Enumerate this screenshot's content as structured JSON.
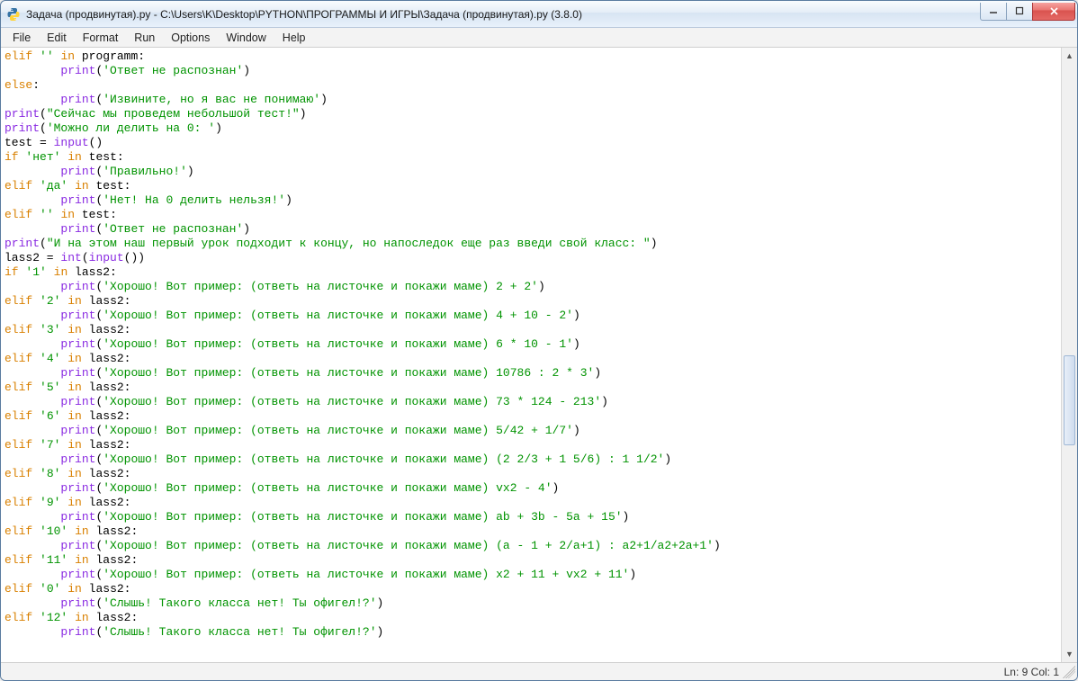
{
  "window": {
    "title": "Задача (продвинутая).py - C:\\Users\\K\\Desktop\\PYTHON\\ПРОГРАММЫ И ИГРЫ\\Задача (продвинутая).py (3.8.0)"
  },
  "menu": {
    "file": "File",
    "edit": "Edit",
    "format": "Format",
    "run": "Run",
    "options": "Options",
    "window": "Window",
    "help": "Help"
  },
  "status": {
    "position": "Ln: 9  Col: 1"
  },
  "code": {
    "lines": [
      [
        {
          "t": "kw",
          "v": "elif"
        },
        {
          "t": "op",
          "v": " "
        },
        {
          "t": "str",
          "v": "''"
        },
        {
          "t": "op",
          "v": " "
        },
        {
          "t": "kw",
          "v": "in"
        },
        {
          "t": "op",
          "v": " programm:"
        }
      ],
      [
        {
          "t": "op",
          "v": "        "
        },
        {
          "t": "fn",
          "v": "print"
        },
        {
          "t": "op",
          "v": "("
        },
        {
          "t": "str",
          "v": "'Ответ не распознан'"
        },
        {
          "t": "op",
          "v": ")"
        }
      ],
      [
        {
          "t": "kw",
          "v": "else"
        },
        {
          "t": "op",
          "v": ":"
        }
      ],
      [
        {
          "t": "op",
          "v": "        "
        },
        {
          "t": "fn",
          "v": "print"
        },
        {
          "t": "op",
          "v": "("
        },
        {
          "t": "str",
          "v": "'Извините, но я вас не понимаю'"
        },
        {
          "t": "op",
          "v": ")"
        }
      ],
      [
        {
          "t": "fn",
          "v": "print"
        },
        {
          "t": "op",
          "v": "("
        },
        {
          "t": "str",
          "v": "\"Сейчас мы проведем небольшой тест!\""
        },
        {
          "t": "op",
          "v": ")"
        }
      ],
      [
        {
          "t": "fn",
          "v": "print"
        },
        {
          "t": "op",
          "v": "("
        },
        {
          "t": "str",
          "v": "'Можно ли делить на 0: '"
        },
        {
          "t": "op",
          "v": ")"
        }
      ],
      [
        {
          "t": "op",
          "v": "test = "
        },
        {
          "t": "fn",
          "v": "input"
        },
        {
          "t": "op",
          "v": "()"
        }
      ],
      [
        {
          "t": "kw",
          "v": "if"
        },
        {
          "t": "op",
          "v": " "
        },
        {
          "t": "str",
          "v": "'нет'"
        },
        {
          "t": "op",
          "v": " "
        },
        {
          "t": "kw",
          "v": "in"
        },
        {
          "t": "op",
          "v": " test:"
        }
      ],
      [
        {
          "t": "op",
          "v": "        "
        },
        {
          "t": "fn",
          "v": "print"
        },
        {
          "t": "op",
          "v": "("
        },
        {
          "t": "str",
          "v": "'Правильно!'"
        },
        {
          "t": "op",
          "v": ")"
        }
      ],
      [
        {
          "t": "kw",
          "v": "elif"
        },
        {
          "t": "op",
          "v": " "
        },
        {
          "t": "str",
          "v": "'да'"
        },
        {
          "t": "op",
          "v": " "
        },
        {
          "t": "kw",
          "v": "in"
        },
        {
          "t": "op",
          "v": " test:"
        }
      ],
      [
        {
          "t": "op",
          "v": "        "
        },
        {
          "t": "fn",
          "v": "print"
        },
        {
          "t": "op",
          "v": "("
        },
        {
          "t": "str",
          "v": "'Нет! На 0 делить нельзя!'"
        },
        {
          "t": "op",
          "v": ")"
        }
      ],
      [
        {
          "t": "kw",
          "v": "elif"
        },
        {
          "t": "op",
          "v": " "
        },
        {
          "t": "str",
          "v": "''"
        },
        {
          "t": "op",
          "v": " "
        },
        {
          "t": "kw",
          "v": "in"
        },
        {
          "t": "op",
          "v": " test:"
        }
      ],
      [
        {
          "t": "op",
          "v": "        "
        },
        {
          "t": "fn",
          "v": "print"
        },
        {
          "t": "op",
          "v": "("
        },
        {
          "t": "str",
          "v": "'Ответ не распознан'"
        },
        {
          "t": "op",
          "v": ")"
        }
      ],
      [
        {
          "t": "fn",
          "v": "print"
        },
        {
          "t": "op",
          "v": "("
        },
        {
          "t": "str",
          "v": "\"И на этом наш первый урок подходит к концу, но напоследок еще раз введи свой класс: \""
        },
        {
          "t": "op",
          "v": ")"
        }
      ],
      [
        {
          "t": "op",
          "v": "lass2 = "
        },
        {
          "t": "fn",
          "v": "int"
        },
        {
          "t": "op",
          "v": "("
        },
        {
          "t": "fn",
          "v": "input"
        },
        {
          "t": "op",
          "v": "())"
        }
      ],
      [
        {
          "t": "kw",
          "v": "if"
        },
        {
          "t": "op",
          "v": " "
        },
        {
          "t": "str",
          "v": "'1'"
        },
        {
          "t": "op",
          "v": " "
        },
        {
          "t": "kw",
          "v": "in"
        },
        {
          "t": "op",
          "v": " lass2:"
        }
      ],
      [
        {
          "t": "op",
          "v": "        "
        },
        {
          "t": "fn",
          "v": "print"
        },
        {
          "t": "op",
          "v": "("
        },
        {
          "t": "str",
          "v": "'Хорошо! Вот пример: (ответь на листочке и покажи маме) 2 + 2'"
        },
        {
          "t": "op",
          "v": ")"
        }
      ],
      [
        {
          "t": "kw",
          "v": "elif"
        },
        {
          "t": "op",
          "v": " "
        },
        {
          "t": "str",
          "v": "'2'"
        },
        {
          "t": "op",
          "v": " "
        },
        {
          "t": "kw",
          "v": "in"
        },
        {
          "t": "op",
          "v": " lass2:"
        }
      ],
      [
        {
          "t": "op",
          "v": "        "
        },
        {
          "t": "fn",
          "v": "print"
        },
        {
          "t": "op",
          "v": "("
        },
        {
          "t": "str",
          "v": "'Хорошо! Вот пример: (ответь на листочке и покажи маме) 4 + 10 - 2'"
        },
        {
          "t": "op",
          "v": ")"
        }
      ],
      [
        {
          "t": "kw",
          "v": "elif"
        },
        {
          "t": "op",
          "v": " "
        },
        {
          "t": "str",
          "v": "'3'"
        },
        {
          "t": "op",
          "v": " "
        },
        {
          "t": "kw",
          "v": "in"
        },
        {
          "t": "op",
          "v": " lass2:"
        }
      ],
      [
        {
          "t": "op",
          "v": "        "
        },
        {
          "t": "fn",
          "v": "print"
        },
        {
          "t": "op",
          "v": "("
        },
        {
          "t": "str",
          "v": "'Хорошо! Вот пример: (ответь на листочке и покажи маме) 6 * 10 - 1'"
        },
        {
          "t": "op",
          "v": ")"
        }
      ],
      [
        {
          "t": "kw",
          "v": "elif"
        },
        {
          "t": "op",
          "v": " "
        },
        {
          "t": "str",
          "v": "'4'"
        },
        {
          "t": "op",
          "v": " "
        },
        {
          "t": "kw",
          "v": "in"
        },
        {
          "t": "op",
          "v": " lass2:"
        }
      ],
      [
        {
          "t": "op",
          "v": "        "
        },
        {
          "t": "fn",
          "v": "print"
        },
        {
          "t": "op",
          "v": "("
        },
        {
          "t": "str",
          "v": "'Хорошо! Вот пример: (ответь на листочке и покажи маме) 10786 : 2 * 3'"
        },
        {
          "t": "op",
          "v": ")"
        }
      ],
      [
        {
          "t": "kw",
          "v": "elif"
        },
        {
          "t": "op",
          "v": " "
        },
        {
          "t": "str",
          "v": "'5'"
        },
        {
          "t": "op",
          "v": " "
        },
        {
          "t": "kw",
          "v": "in"
        },
        {
          "t": "op",
          "v": " lass2:"
        }
      ],
      [
        {
          "t": "op",
          "v": "        "
        },
        {
          "t": "fn",
          "v": "print"
        },
        {
          "t": "op",
          "v": "("
        },
        {
          "t": "str",
          "v": "'Хорошо! Вот пример: (ответь на листочке и покажи маме) 73 * 124 - 213'"
        },
        {
          "t": "op",
          "v": ")"
        }
      ],
      [
        {
          "t": "kw",
          "v": "elif"
        },
        {
          "t": "op",
          "v": " "
        },
        {
          "t": "str",
          "v": "'6'"
        },
        {
          "t": "op",
          "v": " "
        },
        {
          "t": "kw",
          "v": "in"
        },
        {
          "t": "op",
          "v": " lass2:"
        }
      ],
      [
        {
          "t": "op",
          "v": "        "
        },
        {
          "t": "fn",
          "v": "print"
        },
        {
          "t": "op",
          "v": "("
        },
        {
          "t": "str",
          "v": "'Хорошо! Вот пример: (ответь на листочке и покажи маме) 5/42 + 1/7'"
        },
        {
          "t": "op",
          "v": ")"
        }
      ],
      [
        {
          "t": "kw",
          "v": "elif"
        },
        {
          "t": "op",
          "v": " "
        },
        {
          "t": "str",
          "v": "'7'"
        },
        {
          "t": "op",
          "v": " "
        },
        {
          "t": "kw",
          "v": "in"
        },
        {
          "t": "op",
          "v": " lass2:"
        }
      ],
      [
        {
          "t": "op",
          "v": "        "
        },
        {
          "t": "fn",
          "v": "print"
        },
        {
          "t": "op",
          "v": "("
        },
        {
          "t": "str",
          "v": "'Хорошо! Вот пример: (ответь на листочке и покажи маме) (2 2/3 + 1 5/6) : 1 1/2'"
        },
        {
          "t": "op",
          "v": ")"
        }
      ],
      [
        {
          "t": "kw",
          "v": "elif"
        },
        {
          "t": "op",
          "v": " "
        },
        {
          "t": "str",
          "v": "'8'"
        },
        {
          "t": "op",
          "v": " "
        },
        {
          "t": "kw",
          "v": "in"
        },
        {
          "t": "op",
          "v": " lass2:"
        }
      ],
      [
        {
          "t": "op",
          "v": "        "
        },
        {
          "t": "fn",
          "v": "print"
        },
        {
          "t": "op",
          "v": "("
        },
        {
          "t": "str",
          "v": "'Хорошо! Вот пример: (ответь на листочке и покажи маме) vx2 - 4'"
        },
        {
          "t": "op",
          "v": ")"
        }
      ],
      [
        {
          "t": "kw",
          "v": "elif"
        },
        {
          "t": "op",
          "v": " "
        },
        {
          "t": "str",
          "v": "'9'"
        },
        {
          "t": "op",
          "v": " "
        },
        {
          "t": "kw",
          "v": "in"
        },
        {
          "t": "op",
          "v": " lass2:"
        }
      ],
      [
        {
          "t": "op",
          "v": "        "
        },
        {
          "t": "fn",
          "v": "print"
        },
        {
          "t": "op",
          "v": "("
        },
        {
          "t": "str",
          "v": "'Хорошо! Вот пример: (ответь на листочке и покажи маме) ab + 3b - 5a + 15'"
        },
        {
          "t": "op",
          "v": ")"
        }
      ],
      [
        {
          "t": "kw",
          "v": "elif"
        },
        {
          "t": "op",
          "v": " "
        },
        {
          "t": "str",
          "v": "'10'"
        },
        {
          "t": "op",
          "v": " "
        },
        {
          "t": "kw",
          "v": "in"
        },
        {
          "t": "op",
          "v": " lass2:"
        }
      ],
      [
        {
          "t": "op",
          "v": "        "
        },
        {
          "t": "fn",
          "v": "print"
        },
        {
          "t": "op",
          "v": "("
        },
        {
          "t": "str",
          "v": "'Хорошо! Вот пример: (ответь на листочке и покажи маме) (a - 1 + 2/a+1) : a2+1/a2+2a+1'"
        },
        {
          "t": "op",
          "v": ")"
        }
      ],
      [
        {
          "t": "kw",
          "v": "elif"
        },
        {
          "t": "op",
          "v": " "
        },
        {
          "t": "str",
          "v": "'11'"
        },
        {
          "t": "op",
          "v": " "
        },
        {
          "t": "kw",
          "v": "in"
        },
        {
          "t": "op",
          "v": " lass2:"
        }
      ],
      [
        {
          "t": "op",
          "v": "        "
        },
        {
          "t": "fn",
          "v": "print"
        },
        {
          "t": "op",
          "v": "("
        },
        {
          "t": "str",
          "v": "'Хорошо! Вот пример: (ответь на листочке и покажи маме) x2 + 11 + vx2 + 11'"
        },
        {
          "t": "op",
          "v": ")"
        }
      ],
      [
        {
          "t": "kw",
          "v": "elif"
        },
        {
          "t": "op",
          "v": " "
        },
        {
          "t": "str",
          "v": "'0'"
        },
        {
          "t": "op",
          "v": " "
        },
        {
          "t": "kw",
          "v": "in"
        },
        {
          "t": "op",
          "v": " lass2:"
        }
      ],
      [
        {
          "t": "op",
          "v": "        "
        },
        {
          "t": "fn",
          "v": "print"
        },
        {
          "t": "op",
          "v": "("
        },
        {
          "t": "str",
          "v": "'Слышь! Такого класса нет! Ты офигел!?'"
        },
        {
          "t": "op",
          "v": ")"
        }
      ],
      [
        {
          "t": "kw",
          "v": "elif"
        },
        {
          "t": "op",
          "v": " "
        },
        {
          "t": "str",
          "v": "'12'"
        },
        {
          "t": "op",
          "v": " "
        },
        {
          "t": "kw",
          "v": "in"
        },
        {
          "t": "op",
          "v": " lass2:"
        }
      ],
      [
        {
          "t": "op",
          "v": "        "
        },
        {
          "t": "fn",
          "v": "print"
        },
        {
          "t": "op",
          "v": "("
        },
        {
          "t": "str",
          "v": "'Слышь! Такого класса нет! Ты офигел!?'"
        },
        {
          "t": "op",
          "v": ")"
        }
      ]
    ]
  }
}
